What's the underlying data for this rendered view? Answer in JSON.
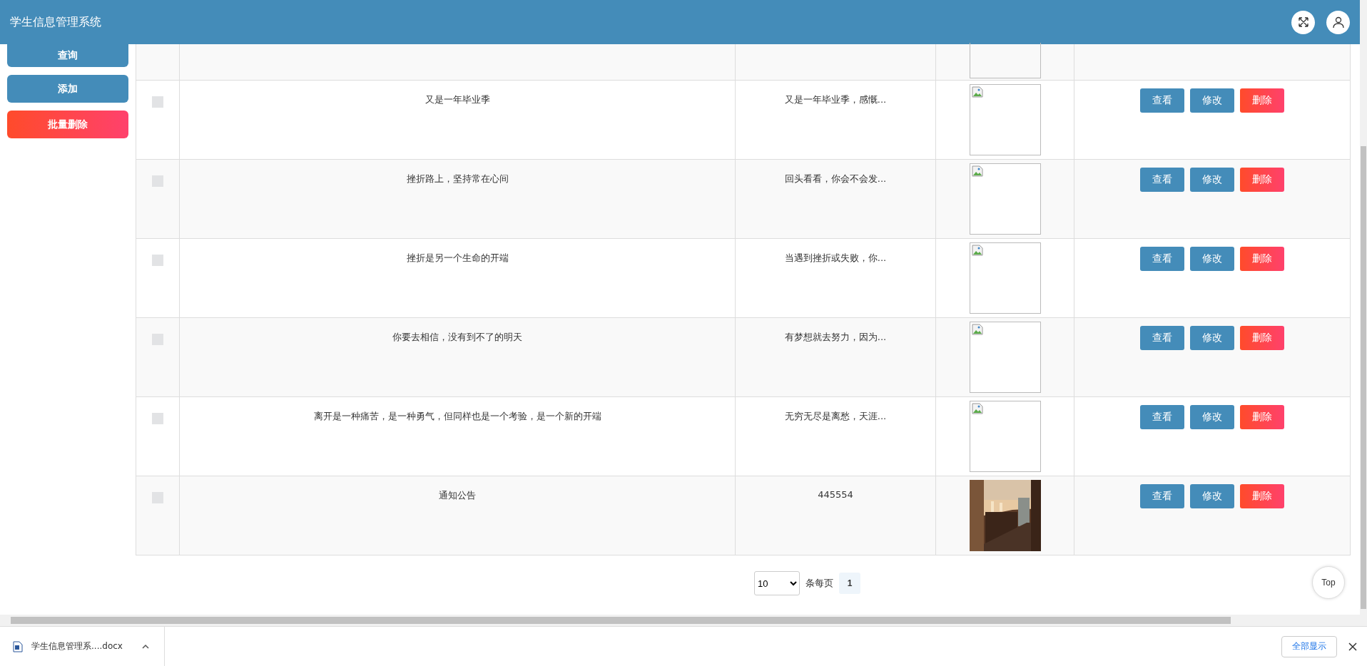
{
  "header": {
    "title": "学生信息管理系统"
  },
  "sidebar": {
    "buttons": [
      {
        "label": "查询",
        "kind": "primary"
      },
      {
        "label": "添加",
        "kind": "primary"
      },
      {
        "label": "批量删除",
        "kind": "danger"
      }
    ]
  },
  "table": {
    "partial_row": {
      "image": {
        "kind": "broken"
      }
    },
    "rows": [
      {
        "checked": false,
        "title": "又是一年毕业季",
        "content": "又是一年毕业季，感慨...",
        "image": {
          "kind": "broken"
        },
        "actions": [
          {
            "label": "查看",
            "kind": "primary"
          },
          {
            "label": "修改",
            "kind": "primary"
          },
          {
            "label": "删除",
            "kind": "danger"
          }
        ]
      },
      {
        "checked": false,
        "title": "挫折路上，坚持常在心间",
        "content": "回头看看，你会不会发...",
        "image": {
          "kind": "broken"
        },
        "actions": [
          {
            "label": "查看",
            "kind": "primary"
          },
          {
            "label": "修改",
            "kind": "primary"
          },
          {
            "label": "删除",
            "kind": "danger"
          }
        ]
      },
      {
        "checked": false,
        "title": "挫折是另一个生命的开端",
        "content": "当遇到挫折或失败，你...",
        "image": {
          "kind": "broken"
        },
        "actions": [
          {
            "label": "查看",
            "kind": "primary"
          },
          {
            "label": "修改",
            "kind": "primary"
          },
          {
            "label": "删除",
            "kind": "danger"
          }
        ]
      },
      {
        "checked": false,
        "title": "你要去相信，没有到不了的明天",
        "content": "有梦想就去努力，因为...",
        "image": {
          "kind": "broken"
        },
        "actions": [
          {
            "label": "查看",
            "kind": "primary"
          },
          {
            "label": "修改",
            "kind": "primary"
          },
          {
            "label": "删除",
            "kind": "danger"
          }
        ]
      },
      {
        "checked": false,
        "title": "离开是一种痛苦，是一种勇气，但同样也是一个考验，是一个新的开端",
        "content": "无穷无尽是离愁，天涯...",
        "image": {
          "kind": "broken"
        },
        "actions": [
          {
            "label": "查看",
            "kind": "primary"
          },
          {
            "label": "修改",
            "kind": "primary"
          },
          {
            "label": "删除",
            "kind": "danger"
          }
        ]
      },
      {
        "checked": false,
        "title": "通知公告",
        "content": "445554",
        "actions": [
          {
            "label": "查看",
            "kind": "primary"
          },
          {
            "label": "修改",
            "kind": "primary"
          },
          {
            "label": "删除",
            "kind": "danger"
          }
        ]
      }
    ]
  },
  "pagination": {
    "page_size": "10",
    "per_page_label": "条每页",
    "pages": [
      {
        "label": "1",
        "selected": true
      }
    ]
  },
  "top_button": "Top",
  "download_bar": {
    "file": "学生信息管理系....docx",
    "show_all": "全部显示"
  }
}
